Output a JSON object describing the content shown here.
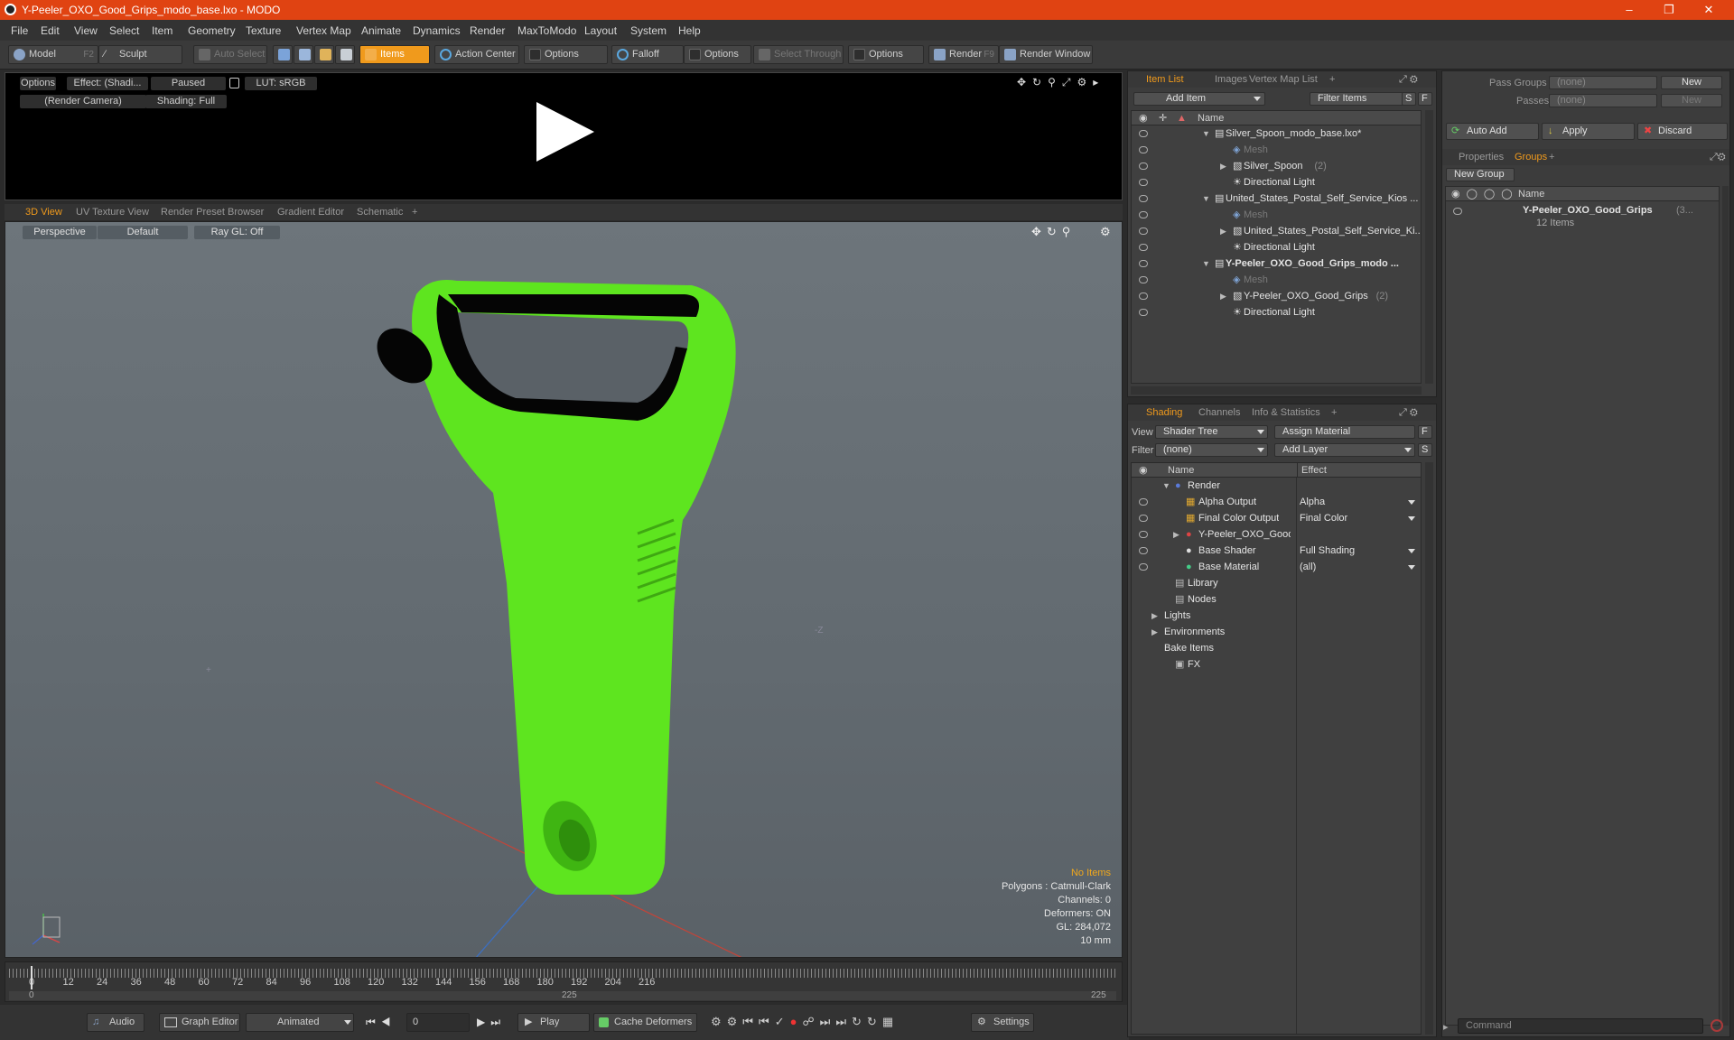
{
  "window": {
    "title": "Y-Peeler_OXO_Good_Grips_modo_base.lxo - MODO"
  },
  "menu": [
    "File",
    "Edit",
    "View",
    "Select",
    "Item",
    "Geometry",
    "Texture",
    "Vertex Map",
    "Animate",
    "Dynamics",
    "Render",
    "MaxToModo",
    "Layout",
    "System",
    "Help"
  ],
  "toolbar": {
    "model": "Model",
    "model_key": "F2",
    "sculpt": "Sculpt",
    "auto_select": "Auto Select",
    "items": "Items",
    "action_center": "Action Center",
    "options1": "Options",
    "falloff": "Falloff",
    "options2": "Options",
    "select_through": "Select Through",
    "options3": "Options",
    "render": "Render",
    "render_key": "F9",
    "render_window": "Render Window"
  },
  "render_preview": {
    "options": "Options",
    "effect": "Effect: (Shadi...",
    "paused": "Paused",
    "lut": "LUT: sRGB",
    "camera": "(Render Camera)",
    "shading": "Shading: Full"
  },
  "view_tabs": [
    "3D View",
    "UV Texture View",
    "Render Preset Browser",
    "Gradient Editor",
    "Schematic",
    "+"
  ],
  "viewport": {
    "projection": "Perspective",
    "style": "Default",
    "raygl": "Ray GL: Off"
  },
  "hud": {
    "no_items": "No Items",
    "polygons": "Polygons : Catmull-Clark",
    "channels": "Channels: 0",
    "deformers": "Deformers: ON",
    "gl": "GL: 284,072",
    "scale": "10 mm"
  },
  "timeline": {
    "ticks": [
      "0",
      "12",
      "24",
      "36",
      "48",
      "60",
      "72",
      "84",
      "96",
      "108",
      "120",
      "132",
      "144",
      "156",
      "168",
      "180",
      "192",
      "204",
      "216"
    ],
    "range_start": "0",
    "range_mid": "225",
    "range_end": "225"
  },
  "bottom": {
    "audio": "Audio",
    "graph_editor": "Graph Editor",
    "animated": "Animated",
    "frame": "0",
    "play": "Play",
    "cache_deformers": "Cache Deformers",
    "settings": "Settings"
  },
  "item_list": {
    "tabs": [
      "Item List",
      "Images",
      "Vertex Map List",
      "+"
    ],
    "add_item": "Add Item",
    "filter_items": "Filter Items",
    "col_name": "Name",
    "rows": [
      {
        "label": "Silver_Spoon_modo_base.lxo*",
        "style": "scene"
      },
      {
        "label": "Mesh",
        "style": "dim"
      },
      {
        "label": "Silver_Spoon",
        "count": "(2)",
        "style": "item"
      },
      {
        "label": "Directional Light",
        "style": "item"
      },
      {
        "label": "United_States_Postal_Self_Service_Kios ...",
        "style": "scene"
      },
      {
        "label": "Mesh",
        "style": "dim"
      },
      {
        "label": "United_States_Postal_Self_Service_Ki...",
        "style": "item"
      },
      {
        "label": "Directional Light",
        "style": "item"
      },
      {
        "label": "Y-Peeler_OXO_Good_Grips_modo ...",
        "style": "bold"
      },
      {
        "label": "Mesh",
        "style": "dim"
      },
      {
        "label": "Y-Peeler_OXO_Good_Grips",
        "count": "(2)",
        "style": "item"
      },
      {
        "label": "Directional Light",
        "style": "item"
      }
    ]
  },
  "shading": {
    "tabs": [
      "Shading",
      "Channels",
      "Info & Statistics",
      "+"
    ],
    "view_label": "View",
    "view_value": "Shader Tree",
    "assign_material": "Assign Material",
    "filter_label": "Filter",
    "filter_value": "(none)",
    "add_layer": "Add Layer",
    "col_name": "Name",
    "col_effect": "Effect",
    "rows": [
      {
        "label": "Render",
        "effect": ""
      },
      {
        "label": "Alpha Output",
        "effect": "Alpha"
      },
      {
        "label": "Final Color Output",
        "effect": "Final Color"
      },
      {
        "label": "Y-Peeler_OXO_Good_Grips...",
        "effect": ""
      },
      {
        "label": "Base Shader",
        "effect": "Full Shading"
      },
      {
        "label": "Base Material",
        "effect": "(all)"
      },
      {
        "label": "Library",
        "effect": ""
      },
      {
        "label": "Nodes",
        "effect": ""
      },
      {
        "label": "Lights",
        "effect": ""
      },
      {
        "label": "Environments",
        "effect": ""
      },
      {
        "label": "Bake Items",
        "effect": ""
      },
      {
        "label": "FX",
        "effect": ""
      }
    ]
  },
  "groups": {
    "pass_groups_label": "Pass Groups",
    "pass_groups_value": "(none)",
    "new": "New",
    "passes_label": "Passes",
    "passes_value": "(none)",
    "new2": "New",
    "auto_add": "Auto Add",
    "apply": "Apply",
    "discard": "Discard",
    "tabs": [
      "Properties",
      "Groups",
      "+"
    ],
    "new_group": "New Group",
    "col_name": "Name",
    "group_name": "Y-Peeler_OXO_Good_Grips",
    "group_count": "(3...",
    "group_items": "12 Items"
  },
  "command": {
    "placeholder": "Command"
  },
  "colors": {
    "title_bar": "#e04312",
    "accent": "#f09a1c",
    "model_green": "#5ee51f"
  }
}
